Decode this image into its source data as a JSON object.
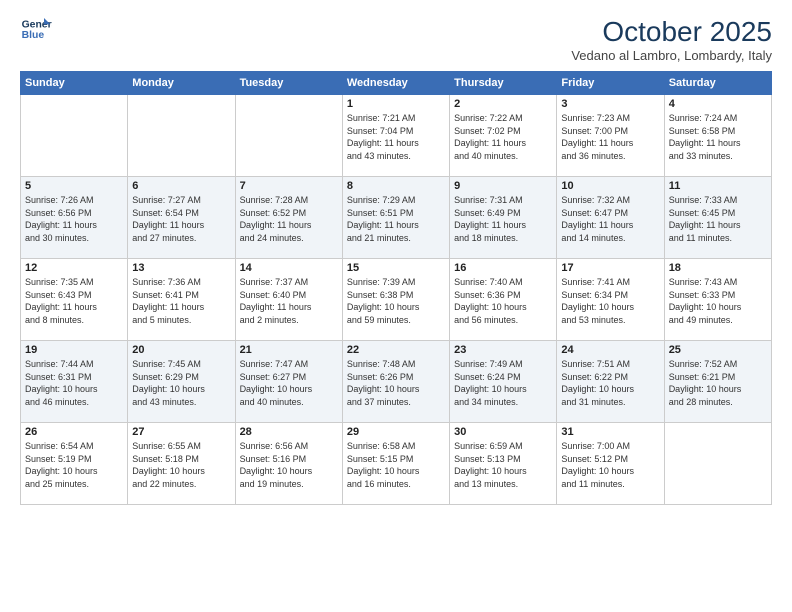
{
  "header": {
    "logo_line1": "General",
    "logo_line2": "Blue",
    "month": "October 2025",
    "location": "Vedano al Lambro, Lombardy, Italy"
  },
  "days_of_week": [
    "Sunday",
    "Monday",
    "Tuesday",
    "Wednesday",
    "Thursday",
    "Friday",
    "Saturday"
  ],
  "weeks": [
    [
      {
        "day": "",
        "info": ""
      },
      {
        "day": "",
        "info": ""
      },
      {
        "day": "",
        "info": ""
      },
      {
        "day": "1",
        "info": "Sunrise: 7:21 AM\nSunset: 7:04 PM\nDaylight: 11 hours\nand 43 minutes."
      },
      {
        "day": "2",
        "info": "Sunrise: 7:22 AM\nSunset: 7:02 PM\nDaylight: 11 hours\nand 40 minutes."
      },
      {
        "day": "3",
        "info": "Sunrise: 7:23 AM\nSunset: 7:00 PM\nDaylight: 11 hours\nand 36 minutes."
      },
      {
        "day": "4",
        "info": "Sunrise: 7:24 AM\nSunset: 6:58 PM\nDaylight: 11 hours\nand 33 minutes."
      }
    ],
    [
      {
        "day": "5",
        "info": "Sunrise: 7:26 AM\nSunset: 6:56 PM\nDaylight: 11 hours\nand 30 minutes."
      },
      {
        "day": "6",
        "info": "Sunrise: 7:27 AM\nSunset: 6:54 PM\nDaylight: 11 hours\nand 27 minutes."
      },
      {
        "day": "7",
        "info": "Sunrise: 7:28 AM\nSunset: 6:52 PM\nDaylight: 11 hours\nand 24 minutes."
      },
      {
        "day": "8",
        "info": "Sunrise: 7:29 AM\nSunset: 6:51 PM\nDaylight: 11 hours\nand 21 minutes."
      },
      {
        "day": "9",
        "info": "Sunrise: 7:31 AM\nSunset: 6:49 PM\nDaylight: 11 hours\nand 18 minutes."
      },
      {
        "day": "10",
        "info": "Sunrise: 7:32 AM\nSunset: 6:47 PM\nDaylight: 11 hours\nand 14 minutes."
      },
      {
        "day": "11",
        "info": "Sunrise: 7:33 AM\nSunset: 6:45 PM\nDaylight: 11 hours\nand 11 minutes."
      }
    ],
    [
      {
        "day": "12",
        "info": "Sunrise: 7:35 AM\nSunset: 6:43 PM\nDaylight: 11 hours\nand 8 minutes."
      },
      {
        "day": "13",
        "info": "Sunrise: 7:36 AM\nSunset: 6:41 PM\nDaylight: 11 hours\nand 5 minutes."
      },
      {
        "day": "14",
        "info": "Sunrise: 7:37 AM\nSunset: 6:40 PM\nDaylight: 11 hours\nand 2 minutes."
      },
      {
        "day": "15",
        "info": "Sunrise: 7:39 AM\nSunset: 6:38 PM\nDaylight: 10 hours\nand 59 minutes."
      },
      {
        "day": "16",
        "info": "Sunrise: 7:40 AM\nSunset: 6:36 PM\nDaylight: 10 hours\nand 56 minutes."
      },
      {
        "day": "17",
        "info": "Sunrise: 7:41 AM\nSunset: 6:34 PM\nDaylight: 10 hours\nand 53 minutes."
      },
      {
        "day": "18",
        "info": "Sunrise: 7:43 AM\nSunset: 6:33 PM\nDaylight: 10 hours\nand 49 minutes."
      }
    ],
    [
      {
        "day": "19",
        "info": "Sunrise: 7:44 AM\nSunset: 6:31 PM\nDaylight: 10 hours\nand 46 minutes."
      },
      {
        "day": "20",
        "info": "Sunrise: 7:45 AM\nSunset: 6:29 PM\nDaylight: 10 hours\nand 43 minutes."
      },
      {
        "day": "21",
        "info": "Sunrise: 7:47 AM\nSunset: 6:27 PM\nDaylight: 10 hours\nand 40 minutes."
      },
      {
        "day": "22",
        "info": "Sunrise: 7:48 AM\nSunset: 6:26 PM\nDaylight: 10 hours\nand 37 minutes."
      },
      {
        "day": "23",
        "info": "Sunrise: 7:49 AM\nSunset: 6:24 PM\nDaylight: 10 hours\nand 34 minutes."
      },
      {
        "day": "24",
        "info": "Sunrise: 7:51 AM\nSunset: 6:22 PM\nDaylight: 10 hours\nand 31 minutes."
      },
      {
        "day": "25",
        "info": "Sunrise: 7:52 AM\nSunset: 6:21 PM\nDaylight: 10 hours\nand 28 minutes."
      }
    ],
    [
      {
        "day": "26",
        "info": "Sunrise: 6:54 AM\nSunset: 5:19 PM\nDaylight: 10 hours\nand 25 minutes."
      },
      {
        "day": "27",
        "info": "Sunrise: 6:55 AM\nSunset: 5:18 PM\nDaylight: 10 hours\nand 22 minutes."
      },
      {
        "day": "28",
        "info": "Sunrise: 6:56 AM\nSunset: 5:16 PM\nDaylight: 10 hours\nand 19 minutes."
      },
      {
        "day": "29",
        "info": "Sunrise: 6:58 AM\nSunset: 5:15 PM\nDaylight: 10 hours\nand 16 minutes."
      },
      {
        "day": "30",
        "info": "Sunrise: 6:59 AM\nSunset: 5:13 PM\nDaylight: 10 hours\nand 13 minutes."
      },
      {
        "day": "31",
        "info": "Sunrise: 7:00 AM\nSunset: 5:12 PM\nDaylight: 10 hours\nand 11 minutes."
      },
      {
        "day": "",
        "info": ""
      }
    ]
  ]
}
